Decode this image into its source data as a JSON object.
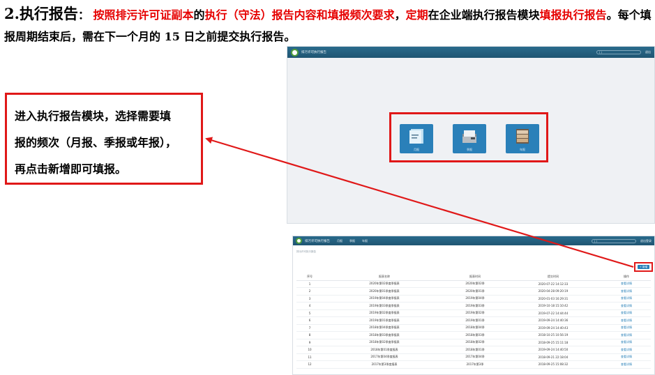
{
  "heading": {
    "num": "2.",
    "title": "执行报告",
    "colon": "：",
    "red1": "按照排污许可证副本",
    "black1": "的",
    "red2": "执行（守法）报告内容和填报频次要求",
    "black2": "，",
    "red3": "定期",
    "black3": "在企业端执行报告模块",
    "red4": "填报执行报告",
    "black4": "。每个填报周期结束后，需在下一个月的 15 日之前提交执行报告。"
  },
  "callout": {
    "line1": "进入执行报告模块，选择需要填",
    "line2": "报的频次（月报、季报或年报），",
    "line3": "再点击新增即可填报。"
  },
  "colors": {
    "accent_red": "#e01818",
    "bar_blue": "#1f5572",
    "tile_blue": "#2a80b9"
  },
  "screen1": {
    "app_title": "排污许可执行报告",
    "user_pill": "(                )",
    "logout": "退出",
    "tiles": [
      {
        "label": "月报",
        "icon": "document-icon"
      },
      {
        "label": "季报",
        "icon": "file-box-icon"
      },
      {
        "label": "年报",
        "icon": "drawer-cabinet-icon"
      }
    ]
  },
  "screen2": {
    "app_title": "排污许可执行报告",
    "nav": [
      "月报",
      "季报",
      "年报"
    ],
    "user_pill": "(                )",
    "logout": "退出登录",
    "breadcrumb": "排污许可执行报告",
    "add_button": "+ 新增",
    "columns": [
      "序号",
      "报表名称",
      "报表时间",
      "提交时间",
      "操作"
    ],
    "rows": [
      [
        "1",
        "2020年第02季度季报表",
        "2020年第02季",
        "2020-07-22 14:12:33",
        "查看详情"
      ],
      [
        "2",
        "2020年第01季度季报表",
        "2020年第01季",
        "2020-04-28 09:20:19",
        "查看详情"
      ],
      [
        "3",
        "2019年第04季度季报表",
        "2019年第04季",
        "2020-01-03 16:29:31",
        "查看详情"
      ],
      [
        "4",
        "2019年第03季度季报表",
        "2019年第03季",
        "2019-10-18 15:10:42",
        "查看详情"
      ],
      [
        "5",
        "2019年第02季度季报表",
        "2019年第02季",
        "2019-07-22 14:44:44",
        "查看详情"
      ],
      [
        "6",
        "2019年第01季度季报表",
        "2019年第01季",
        "2019-09-24 14:40:36",
        "查看详情"
      ],
      [
        "7",
        "2018年第04季度季报表",
        "2018年第04季",
        "2019-09-24 14:40:43",
        "查看详情"
      ],
      [
        "8",
        "2018年第03季度季报表",
        "2018年第03季",
        "2018-10-25 10:56:19",
        "查看详情"
      ],
      [
        "9",
        "2018年第02季度季报表",
        "2018年第02季",
        "2018-09-25 15:11:18",
        "查看详情"
      ],
      [
        "10",
        "2018年第01季度报表",
        "2018年第01季",
        "2019-09-24 14:40:50",
        "查看详情"
      ],
      [
        "11",
        "2017年第04季度报表",
        "2017年第04季",
        "2018-09-21 22:18:04",
        "查看详情"
      ],
      [
        "12",
        "2017年第3季度报表",
        "2017年第3季",
        "2018-09-25 15:08:32",
        "查看详情"
      ]
    ]
  }
}
